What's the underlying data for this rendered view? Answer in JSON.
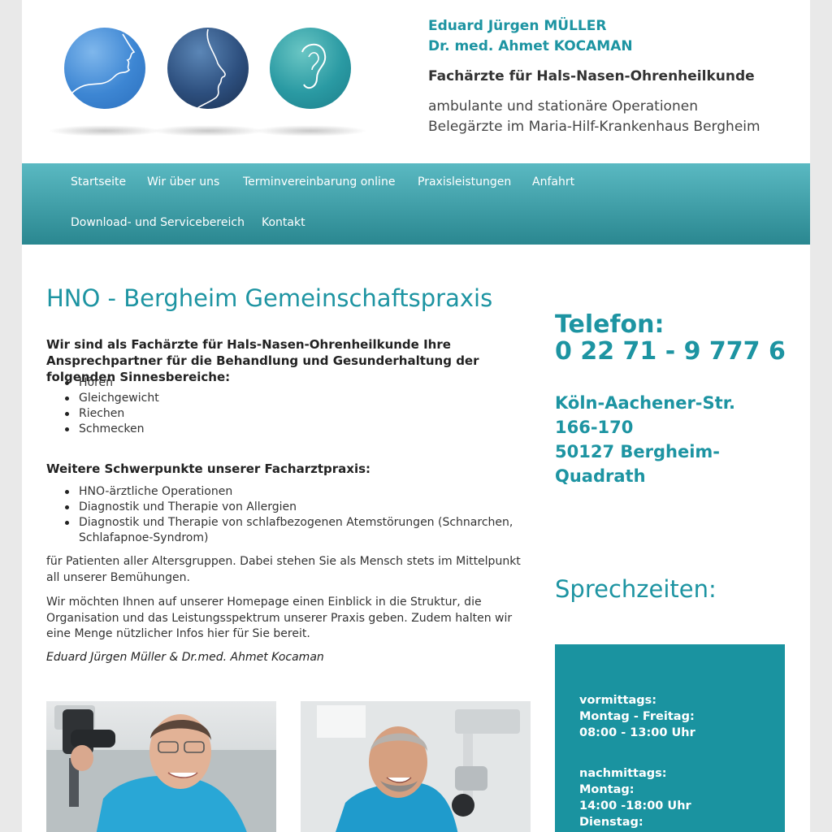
{
  "header": {
    "doctor1": "Eduard Jürgen MÜLLER",
    "doctor2": "Dr. med. Ahmet KOCAMAN",
    "specialty": "Fachärzte für Hals-Nasen-Ohrenheilkunde",
    "subline1": "ambulante und stationäre Operationen",
    "subline2": "Belegärzte im Maria-Hilf-Krankenhaus Bergheim",
    "logo_icons": [
      "face-profile-icon",
      "nose-profile-icon",
      "ear-icon"
    ]
  },
  "nav": {
    "items": [
      "Startseite",
      "Wir über uns",
      "Terminvereinbarung online",
      "Praxisleistungen",
      "Anfahrt",
      "Download- und Servicebereich",
      "Kontakt"
    ]
  },
  "main": {
    "title": "HNO - Bergheim Gemeinschaftspraxis",
    "intro": "Wir sind als Fachärzte für Hals-Nasen-Ohrenheilkunde Ihre Ansprechpartner für die Behandlung und Gesunderhaltung der folgenden Sinnesbereiche:",
    "senses": [
      "Hören",
      "Gleichgewicht",
      "Riechen",
      "Schmecken"
    ],
    "focus_heading": "Weitere Schwerpunkte unserer Facharztpraxis:",
    "focus": [
      "HNO-ärztliche Operationen",
      "Diagnostik und Therapie von Allergien",
      "Diagnostik und Therapie von schlafbezogenen Atemstörungen (Schnarchen, Schlafapnoe-Syndrom)"
    ],
    "paragraph1": "für Patienten aller Altersgruppen. Dabei stehen Sie als Mensch stets im Mittelpunkt all unserer Bemühungen.",
    "paragraph2": "Wir möchten Ihnen auf unserer Homepage einen Einblick in die Struktur, die Organisation und das Leistungsspektrum unserer Praxis geben. Zudem halten wir eine Menge nützlicher Infos hier für Sie bereit.",
    "signature": "Eduard Jürgen Müller & Dr.med. Ahmet Kocaman"
  },
  "sidebar": {
    "phone_label": "Telefon:",
    "phone_number": "0 22 71 - 9 777 6",
    "address_line1": "Köln-Aachener-Str. 166-170",
    "address_line2": "50127 Bergheim-Quadrath",
    "hours_title": "Sprechzeiten:",
    "hours": {
      "morning_label": "vormittags:",
      "morning_days": "Montag - Freitag:",
      "morning_time": "08:00 - 13:00 Uhr",
      "afternoon_label": "nachmittags:",
      "afternoon_day1": "Montag:",
      "afternoon_time1": "14:00 -18:00 Uhr",
      "afternoon_day2": "Dienstag:"
    }
  },
  "colors": {
    "accent": "#1d94a2",
    "nav_top": "#5ab9c2",
    "nav_bottom": "#2a8790",
    "hours_box": "#1a93a0"
  }
}
